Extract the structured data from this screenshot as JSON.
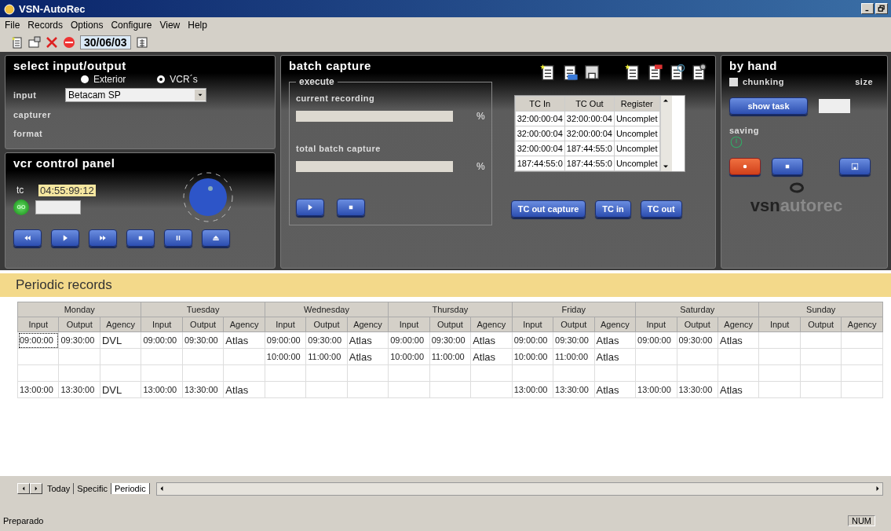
{
  "window": {
    "title": "VSN-AutoRec"
  },
  "menu": [
    "File",
    "Records",
    "Options",
    "Configure",
    "View",
    "Help"
  ],
  "toolbar": {
    "date": "30/06/03"
  },
  "select_io": {
    "title": "select input/output",
    "input_label": "input",
    "input_value": "Betacam SP",
    "capturer_label": "capturer",
    "format_label": "format",
    "radios": [
      {
        "label": "Exterior",
        "selected": false
      },
      {
        "label": "VCR´s",
        "selected": true
      }
    ]
  },
  "vcr": {
    "title": "vcr control panel",
    "tc_label": "tc",
    "tc_value": "04:55:99:12",
    "go_label": "GO"
  },
  "batch": {
    "title": "batch capture",
    "execute_label": "execute",
    "progress": [
      {
        "label": "current recording",
        "level": 0,
        "unit": "%"
      },
      {
        "label": "total batch capture",
        "level": 0,
        "unit": "%"
      }
    ]
  },
  "register_table": {
    "columns": [
      "TC In",
      "TC Out",
      "Register"
    ],
    "rows": [
      [
        "32:00:00:04",
        "32:00:00:04",
        "Uncomplet"
      ],
      [
        "32:00:00:04",
        "32:00:00:04",
        "Uncomplet"
      ],
      [
        "32:00:00:04",
        "187:44:55:0",
        "Uncomplet"
      ],
      [
        "187:44:55:0",
        "187:44:55:0",
        "Uncomplet"
      ]
    ]
  },
  "batch_buttons": [
    "TC out capture",
    "TC in",
    "TC out"
  ],
  "by_hand": {
    "title": "by hand",
    "chunking": {
      "label": "chunking",
      "checked": false
    },
    "size_label": "size",
    "show_task": "show task",
    "saving_label": "saving"
  },
  "logo": {
    "dark": "vsn",
    "light": "autorec"
  },
  "periodic": {
    "title": "Periodic records",
    "days": [
      {
        "name": "Monday",
        "columns": [
          "Input",
          "Output",
          "Agency"
        ]
      },
      {
        "name": "Tuesday",
        "columns": [
          "Input",
          "Output",
          "Agency"
        ]
      },
      {
        "name": "Wednesday",
        "columns": [
          "Input",
          "Output",
          "Agency"
        ]
      },
      {
        "name": "Thursday",
        "columns": [
          "Input",
          "Output",
          "Agency"
        ]
      },
      {
        "name": "Friday",
        "columns": [
          "Input",
          "Output",
          "Agency"
        ]
      },
      {
        "name": "Saturday",
        "columns": [
          "Input",
          "Output",
          "Agency"
        ]
      },
      {
        "name": "Sunday",
        "columns": [
          "Input",
          "Output",
          "Agency"
        ]
      }
    ],
    "rows": [
      {
        "cells": [
          {
            "input": "09:00:00",
            "output": "09:30:00",
            "agency": "DVL",
            "focused": true
          },
          {
            "input": "09:00:00",
            "output": "09:30:00",
            "agency": "Atlas",
            "focused": false
          },
          {
            "input": "09:00:00",
            "output": "09:30:00",
            "agency": "Atlas",
            "focused": false
          },
          {
            "input": "09:00:00",
            "output": "09:30:00",
            "agency": "Atlas",
            "focused": false
          },
          {
            "input": "09:00:00",
            "output": "09:30:00",
            "agency": "Atlas",
            "focused": false
          },
          {
            "input": "09:00:00",
            "output": "09:30:00",
            "agency": "Atlas",
            "focused": false
          },
          null
        ]
      },
      {
        "cells": [
          null,
          null,
          {
            "input": "10:00:00",
            "output": "11:00:00",
            "agency": "Atlas",
            "focused": false
          },
          {
            "input": "10:00:00",
            "output": "11:00:00",
            "agency": "Atlas",
            "focused": false
          },
          {
            "input": "10:00:00",
            "output": "11:00:00",
            "agency": "Atlas",
            "focused": false
          },
          null,
          null
        ]
      },
      {
        "cells": [
          null,
          null,
          null,
          null,
          null,
          null,
          null
        ]
      },
      {
        "cells": [
          {
            "input": "13:00:00",
            "output": "13:30:00",
            "agency": "DVL",
            "focused": false
          },
          {
            "input": "13:00:00",
            "output": "13:30:00",
            "agency": "Atlas",
            "focused": false
          },
          null,
          null,
          {
            "input": "13:00:00",
            "output": "13:30:00",
            "agency": "Atlas",
            "focused": false
          },
          {
            "input": "13:00:00",
            "output": "13:30:00",
            "agency": "Atlas",
            "focused": false
          },
          null
        ]
      }
    ]
  },
  "sheet_tabs": [
    {
      "label": "Today",
      "selected": false
    },
    {
      "label": "Specific",
      "selected": false
    },
    {
      "label": "Periodic",
      "selected": true
    }
  ],
  "status_bar": {
    "text": "Preparado",
    "indicators": [
      "NUM"
    ]
  }
}
